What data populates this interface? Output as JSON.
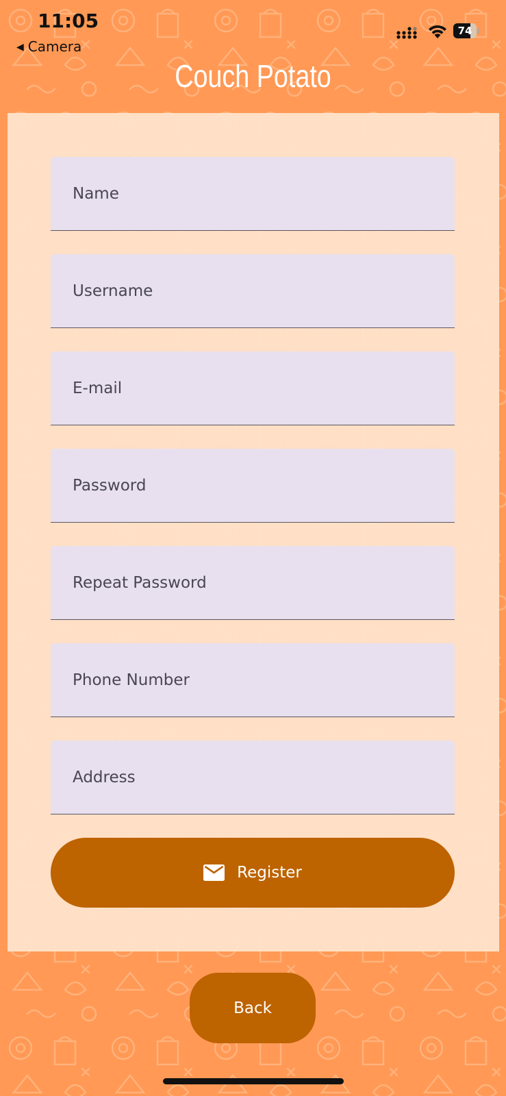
{
  "status_bar": {
    "time": "11:05",
    "back_label": "Camera",
    "battery_level": "74",
    "battery_fraction": 0.74
  },
  "app": {
    "title": "Couch Potato"
  },
  "form": {
    "fields": [
      {
        "placeholder": "Name",
        "value": ""
      },
      {
        "placeholder": "Username",
        "value": ""
      },
      {
        "placeholder": "E-mail",
        "value": ""
      },
      {
        "placeholder": "Password",
        "value": ""
      },
      {
        "placeholder": "Repeat Password",
        "value": ""
      },
      {
        "placeholder": "Phone Number",
        "value": ""
      },
      {
        "placeholder": "Address",
        "value": ""
      }
    ],
    "register_label": "Register",
    "register_icon": "mail-icon"
  },
  "footer": {
    "back_label": "Back"
  },
  "colors": {
    "background": "#ff9955",
    "card": "#ffe4ce",
    "field": "#e8e0ee",
    "button": "#bd6300",
    "title": "#ffffff"
  }
}
